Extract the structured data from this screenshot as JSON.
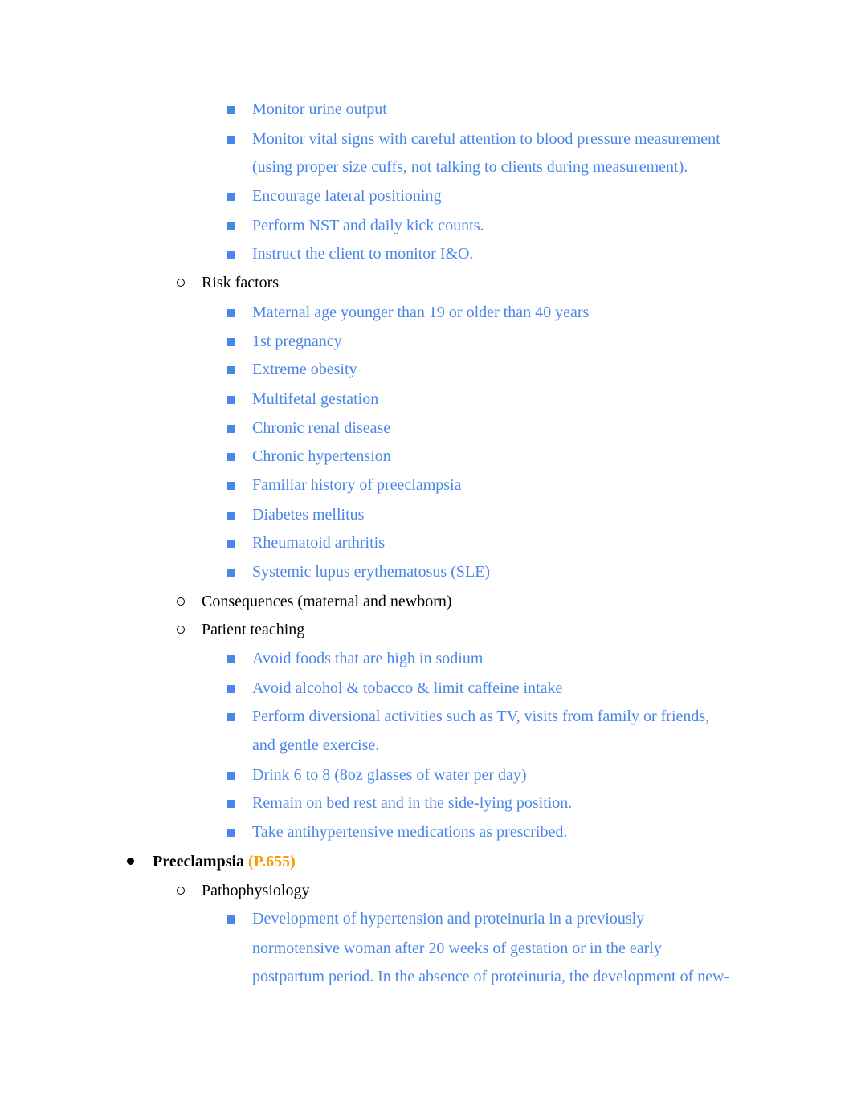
{
  "colors": {
    "body_text": "#000000",
    "sub_text": "#4a86e8",
    "page_ref": "#ff9900"
  },
  "items": [
    {
      "level": 3,
      "text": "Monitor urine output"
    },
    {
      "level": 3,
      "text": "Monitor vital signs with careful attention to blood pressure measurement"
    },
    {
      "level": 3,
      "cont": true,
      "text": "(using proper size cuffs, not talking to clients during measurement)."
    },
    {
      "level": 3,
      "text": "Encourage lateral positioning"
    },
    {
      "level": 3,
      "text": "Perform NST and daily kick counts."
    },
    {
      "level": 3,
      "text": "Instruct the client to monitor I&O."
    },
    {
      "level": 2,
      "text": "Risk factors"
    },
    {
      "level": 3,
      "text": "Maternal age younger than 19 or older than 40 years"
    },
    {
      "level": 3,
      "text": "1st pregnancy"
    },
    {
      "level": 3,
      "text": "Extreme obesity"
    },
    {
      "level": 3,
      "text": "Multifetal gestation"
    },
    {
      "level": 3,
      "text": "Chronic renal disease"
    },
    {
      "level": 3,
      "text": "Chronic hypertension"
    },
    {
      "level": 3,
      "text": "Familiar history of preeclampsia"
    },
    {
      "level": 3,
      "text": "Diabetes mellitus"
    },
    {
      "level": 3,
      "text": "Rheumatoid arthritis"
    },
    {
      "level": 3,
      "text": "Systemic lupus erythematosus (SLE)"
    },
    {
      "level": 2,
      "text": "Consequences (maternal and newborn)"
    },
    {
      "level": 2,
      "text": "Patient teaching"
    },
    {
      "level": 3,
      "text": "Avoid foods that are high in sodium"
    },
    {
      "level": 3,
      "text": "Avoid alcohol & tobacco & limit caffeine intake"
    },
    {
      "level": 3,
      "text": "Perform diversional activities such as TV, visits from family or friends,"
    },
    {
      "level": 3,
      "cont": true,
      "text": "and gentle exercise."
    },
    {
      "level": 3,
      "text": "Drink 6 to 8 (8oz glasses of water per day)"
    },
    {
      "level": 3,
      "text": "Remain on bed rest and in the side-lying position."
    },
    {
      "level": 3,
      "text": "Take antihypertensive medications as prescribed."
    },
    {
      "level": 1,
      "text": "Preeclampsia",
      "ref": "(P.655)"
    },
    {
      "level": 2,
      "text": "Pathophysiology"
    },
    {
      "level": 3,
      "text": "Development of hypertension and proteinuria in a previously"
    },
    {
      "level": 3,
      "cont": true,
      "text": "normotensive woman after 20 weeks of gestation or in the early"
    },
    {
      "level": 3,
      "cont": true,
      "text": "postpartum period. In the absence of proteinuria, the development of new-"
    }
  ]
}
